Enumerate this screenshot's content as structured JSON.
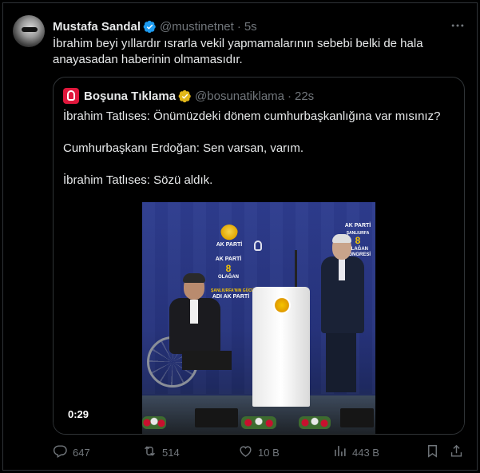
{
  "tweet": {
    "author_name": "Mustafa Sandal",
    "handle": "@mustinetnet",
    "separator": "·",
    "time": "5s",
    "text": "İbrahim beyi yıllardır ısrarla vekil yapmamalarının sebebi belki de hala anayasadan haberinin olmamasıdır.",
    "more_icon": "more-dots-icon"
  },
  "quote": {
    "author_name": "Boşuna Tıklama",
    "handle": "@bosunatiklama",
    "separator": "·",
    "time": "22s",
    "lines": [
      "İbrahim Tatlıses: Önümüzdeki dönem cumhurbaşkanlığına var mısınız?",
      "Cumhurbaşkanı Erdoğan: Sen varsan, varım.",
      "İbrahim Tatlıses: Sözü aldık."
    ],
    "video": {
      "duration": "0:29",
      "stage_text": {
        "brand": "AK PARTİ",
        "city": "ŞANLIURFA",
        "congress_number": "8",
        "congress_line1": "OLAĞAN",
        "congress_line2": "KONGRESİ",
        "banner_top": "ŞANLIURFA'NIN GÜCÜ",
        "banner_main": "ADI AK PARTİ"
      }
    }
  },
  "actions": {
    "reply": {
      "count": "647",
      "icon": "reply-icon"
    },
    "retweet": {
      "count": "514",
      "icon": "retweet-icon"
    },
    "like": {
      "count": "10 B",
      "icon": "heart-icon"
    },
    "views": {
      "count": "443 B",
      "icon": "views-icon"
    },
    "bookmark": {
      "icon": "bookmark-icon"
    },
    "share": {
      "icon": "share-icon"
    }
  },
  "colors": {
    "background": "#000000",
    "text": "#e7e9ea",
    "muted": "#71767b",
    "border": "#2f3336",
    "verified_blue": "#1d9bf0",
    "verified_gold": "#e2b719",
    "quote_avatar_red": "#e0173c"
  }
}
